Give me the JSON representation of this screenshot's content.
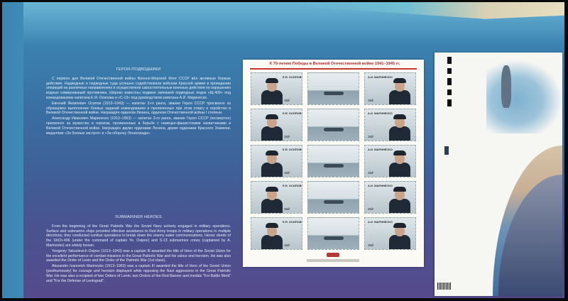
{
  "ru": {
    "heading": "ГЕРОИ-ПОДВОДНИКИ",
    "paragraphs": [
      "С первого дня Великой Отечественной войны Военно-Морской Флот СССР вёл активные боевые действия. Надводные и подводные суда успешно содействовали войскам Красной армии в проведении операций на различных направлениях и осуществляли самостоятельные военные действия по нарушению водных коммуникаций противника. Широко известны подвиги экипажей подводных лодок «Щ-406» под командованием капитана Е.Я. Осипова и «С-13» под руководством капитана А.И. Маринеско.",
      "Евгений Яковлевич Осипов (1913–1943) — капитан 3-го ранга, звание Героя СССР присвоено за образцовое выполнение боевых заданий командования и проявленные при этом отвагу и геройство в Великой Отечественной войне. Награждён орденом Ленина, орденом Отечественной войны I степени.",
      "Александр Иванович Маринеско (1913–1963) — капитан 3-го ранга, звание Героя СССР (посмертно) присвоено за мужество и героизм, проявленные в борьбе с немецко-фашистскими захватчиками в Великой Отечественной войне. Награждён двумя орденами Ленина, двумя орденами Красного Знамени, медалями «За боевые заслуги» и «За оборону Ленинграда»."
    ]
  },
  "en": {
    "heading": "SUBMARINER HEROES",
    "paragraphs": [
      "From the beginning of the Great Patriotic War the Soviet Navy actively engaged in military operations. Surface and submarine ships provided effective assistance to Red Army troops in military operations in multiple directions; they conducted combat operations to break down the enemy water communications. Heroic deeds of the ShCh-406 (under the command of captain Ye. Osipov) and S-13 submarines crews (captained by A. Marinesko) are widely known.",
      "Yevgeniy Yakovlevich Osipov (1913–1943) was a captain III awarded the title of Hero of the Soviet Union for the excellent performance of combat missions in the Great Patriotic War and his valour and heroism. He was also awarded the Order of Lenin and the Order of the Patriotic War (1st class).",
      "Alexander Ivanovich Marinesko (1913–1963) was a captain III awarded the title of Hero of the Soviet Union (posthumously) for courage and heroism displayed while opposing the Nazi aggressors in the Great Patriotic War. He was also a recipient of two Orders of Lenin, two Orders of the Red Banner and medals \"For Battle Merit\" and \"For the Defense of Leningrad\"."
    ]
  },
  "sheet": {
    "title": "К 70-летию Победы в Великой Отечественной войне 1941–1945 гг.",
    "left_name": "Е.Я. ОСИПОВ",
    "right_name": "А.И. МАРИНЕСКО",
    "denomination": "35₽",
    "rows": 5
  },
  "colors": {
    "accent_red": "#c8372f",
    "sea_top": "#3f8fb8",
    "sea_bottom": "#564a8c"
  }
}
